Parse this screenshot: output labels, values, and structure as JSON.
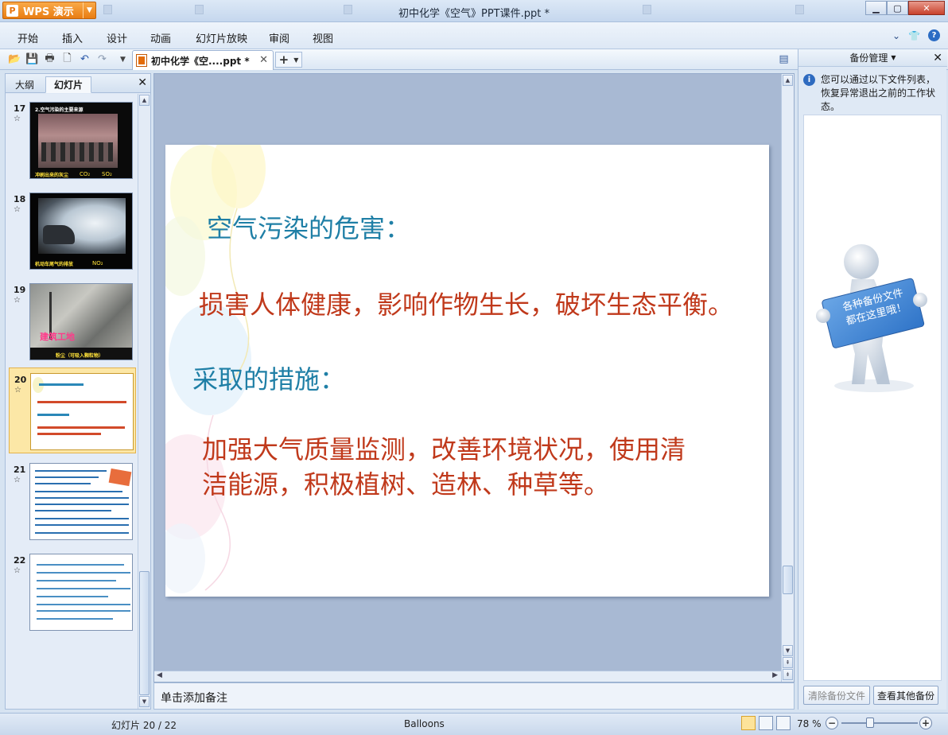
{
  "app": {
    "menu_button": "WPS 演示",
    "window_title": "初中化学《空气》PPT课件.ppt *"
  },
  "menu": [
    "开始",
    "插入",
    "设计",
    "动画",
    "幻灯片放映",
    "审阅",
    "视图"
  ],
  "doc_tab": {
    "label": "初中化学《空....ppt *"
  },
  "left_panel": {
    "tabs": [
      "大纲",
      "幻灯片"
    ],
    "thumbs": [
      {
        "num": "17",
        "caption_a": "冲刷出来的灰尘",
        "caption_b": "CO₂",
        "caption_c": "SO₂"
      },
      {
        "num": "18",
        "caption_a": "机动车尾气的排放",
        "caption_b": "NO₂"
      },
      {
        "num": "19",
        "caption_a": "建筑工地",
        "caption_b": "粉尘（可吸入颗粒物）"
      },
      {
        "num": "20"
      },
      {
        "num": "21"
      },
      {
        "num": "22"
      }
    ]
  },
  "slide": {
    "heading1": "空气污染的危害：",
    "body1": "损害人体健康，影响作物生长，破坏生态平衡。",
    "heading2": "采取的措施：",
    "body2_line1": "加强大气质量监测，改善环境状况，使用清",
    "body2_line2": "洁能源，积极植树、造林、种草等。"
  },
  "notes_placeholder": "单击添加备注",
  "right_panel": {
    "title": "备份管理",
    "info": "您可以通过以下文件列表，恢复异常退出之前的工作状态。",
    "sign_text_1": "各种备份文件",
    "sign_text_2": "都在这里哦！",
    "btn_clear": "清除备份文件",
    "btn_view": "查看其他备份"
  },
  "status": {
    "slide_counter": "幻灯片 20 / 22",
    "theme": "Balloons",
    "zoom": "78 %"
  },
  "colors": {
    "heading": "#1f7fa6",
    "body": "#c0391b",
    "accent": "#e8740e"
  }
}
